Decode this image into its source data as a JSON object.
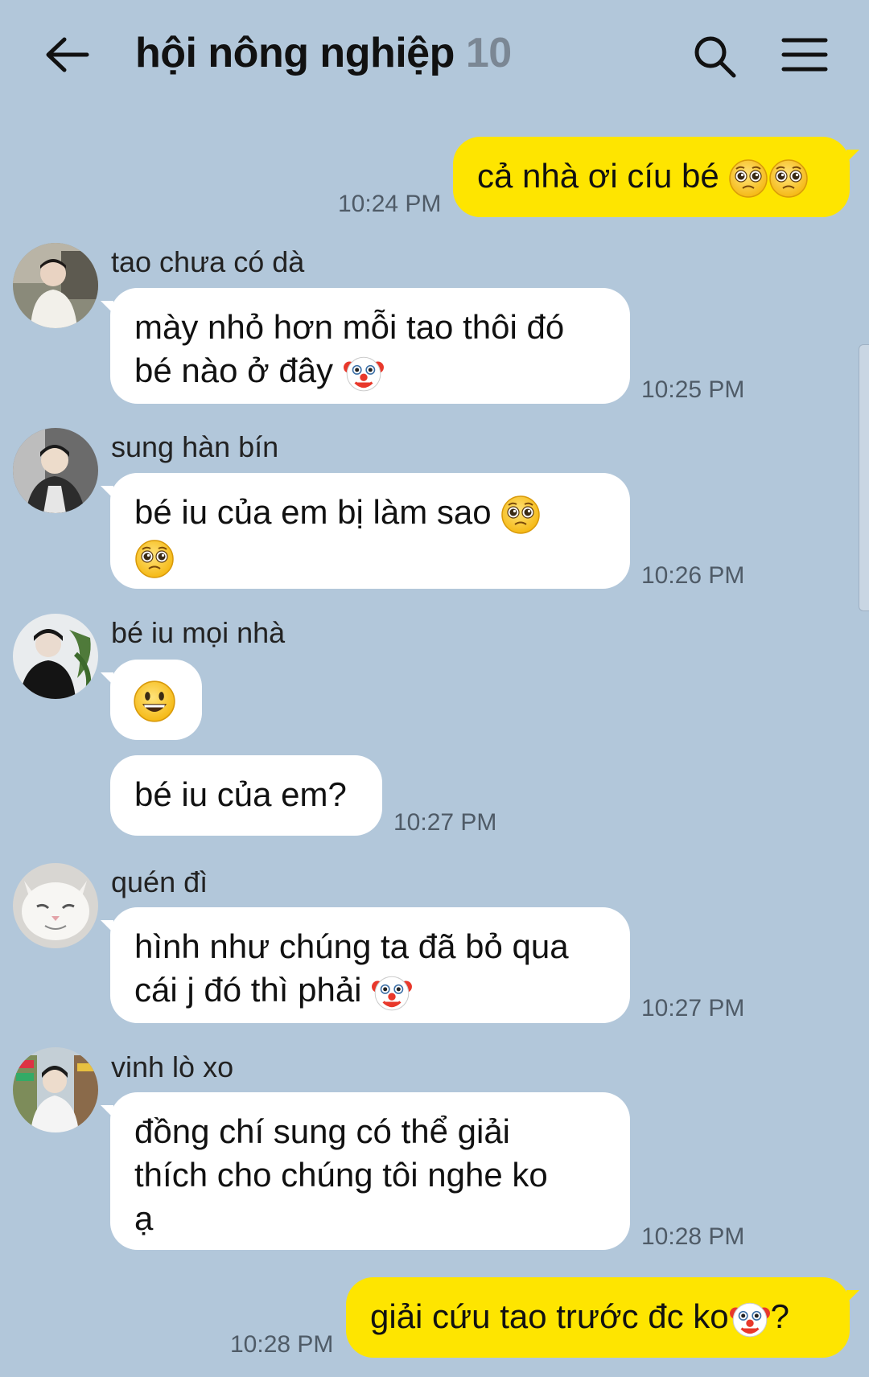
{
  "header": {
    "title": "hội nông nghiệp",
    "member_count": "10"
  },
  "icons": {
    "back": "arrow-left-icon",
    "search": "search-icon",
    "menu": "hamburger-menu-icon"
  },
  "colors": {
    "background": "#b2c7da",
    "my_bubble": "#fee500",
    "other_bubble": "#ffffff",
    "member_count": "#7b8794"
  },
  "messages": [
    {
      "from": "me",
      "text": "cả nhà ơi cíu bé",
      "emojis": [
        "pleading-face",
        "pleading-face"
      ],
      "time": "10:24 PM"
    },
    {
      "from": "tao chưa có dà",
      "text_line1": "mày nhỏ hơn mỗi tao thôi đó",
      "text_line2": "bé nào ở đây",
      "emojis": [
        "clown-face"
      ],
      "time": "10:25 PM"
    },
    {
      "from": "sung hàn bín",
      "text": "bé iu của em bị làm sao",
      "emojis": [
        "pleading-face",
        "pleading-face"
      ],
      "time": "10:26 PM"
    },
    {
      "from": "bé iu mọi nhà",
      "emojis": [
        "grinning-face"
      ],
      "text2": "bé iu của em?",
      "time": "10:27 PM"
    },
    {
      "from": "quén đì",
      "text_line1": "hình như chúng ta đã bỏ qua",
      "text_line2": "cái j đó thì phải",
      "emojis": [
        "clown-face"
      ],
      "time": "10:27 PM"
    },
    {
      "from": "vinh lò xo",
      "text_line1": "đồng chí sung có thể giải",
      "text_line2": "thích cho chúng tôi nghe ko",
      "text_line3": "ạ",
      "time": "10:28 PM"
    },
    {
      "from": "me",
      "text": "giải cứu tao trước đc ko",
      "emojis": [
        "clown-face"
      ],
      "suffix": "?",
      "time": "10:28 PM"
    }
  ]
}
